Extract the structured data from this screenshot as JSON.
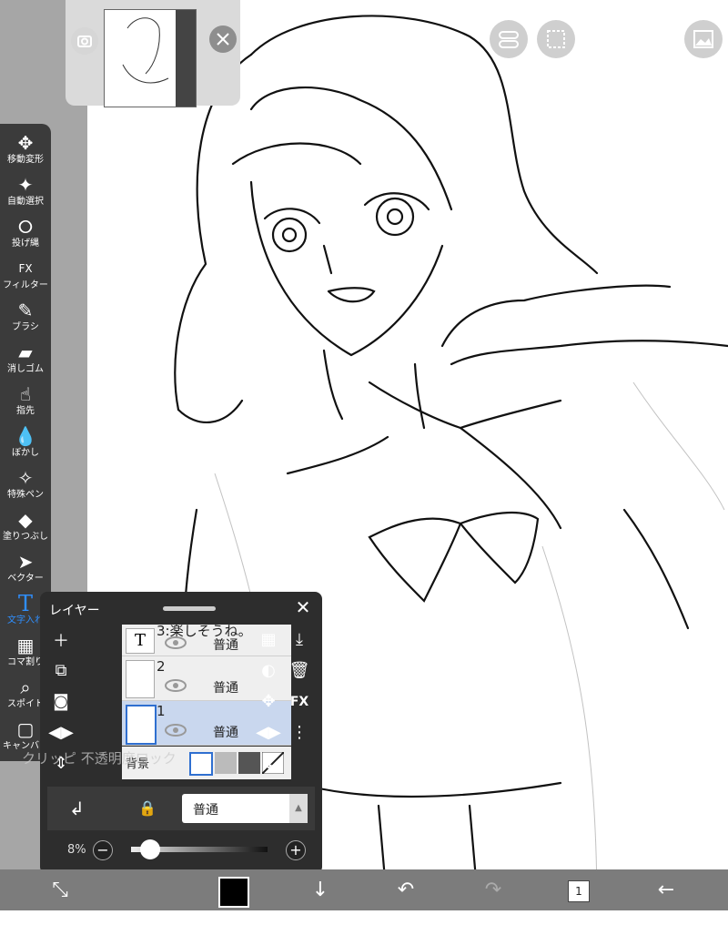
{
  "toolbar": {
    "tools": [
      {
        "label": "移動変形",
        "icon": "move-icon"
      },
      {
        "label": "自動選択",
        "icon": "magic-wand-icon"
      },
      {
        "label": "投げ縄",
        "icon": "lasso-icon"
      },
      {
        "label": "フィルター",
        "icon": "fx-icon"
      },
      {
        "label": "ブラシ",
        "icon": "brush-icon"
      },
      {
        "label": "消しゴム",
        "icon": "eraser-icon"
      },
      {
        "label": "指先",
        "icon": "finger-icon"
      },
      {
        "label": "ぼかし",
        "icon": "blur-icon"
      },
      {
        "label": "特殊ペン",
        "icon": "special-pen-icon"
      },
      {
        "label": "塗りつぶし",
        "icon": "fill-icon"
      },
      {
        "label": "ベクター",
        "icon": "vector-icon"
      },
      {
        "label": "文字入れ",
        "icon": "text-icon"
      },
      {
        "label": "コマ割り",
        "icon": "frame-divider-icon"
      },
      {
        "label": "スポイト",
        "icon": "eyedropper-icon"
      },
      {
        "label": "キャンバス",
        "icon": "canvas-icon"
      }
    ],
    "active": "文字入れ"
  },
  "layer_panel": {
    "title": "レイヤー",
    "layers": [
      {
        "name": "3:楽しそうね。",
        "blend": "普通",
        "type": "T"
      },
      {
        "name": "2",
        "blend": "普通"
      },
      {
        "name": "1",
        "blend": "普通",
        "selected": true
      }
    ],
    "overlay_hint": "クリッピ 不透明度ロック",
    "blend_mode": "普通",
    "opacity_label": "8%",
    "opacity": 0.08,
    "bg_label": "背景"
  },
  "colors": {
    "accent": "#2f8fff",
    "primary_color": "#000000",
    "panel": "#2d2d2d"
  },
  "bottom_bar": {
    "layer_count": "1"
  }
}
